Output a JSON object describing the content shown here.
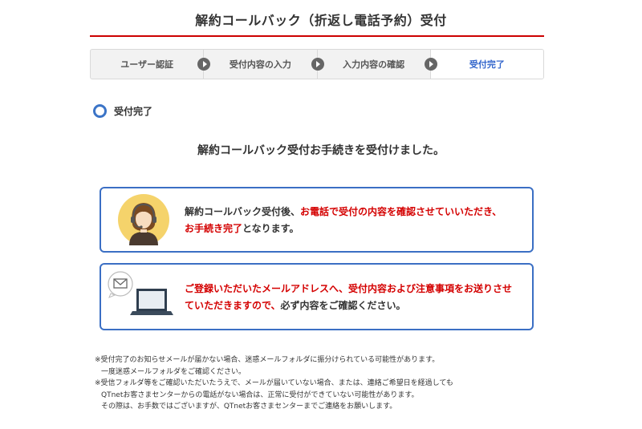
{
  "header": {
    "title": "解約コールバック（折返し電話予約）受付"
  },
  "stepper": {
    "steps": [
      {
        "label": "ユーザー認証"
      },
      {
        "label": "受付内容の入力"
      },
      {
        "label": "入力内容の確認"
      },
      {
        "label": "受付完了"
      }
    ],
    "active_index": 3
  },
  "section": {
    "title": "受付完了"
  },
  "message": {
    "headline": "解約コールバック受付お手続きを受付けました。"
  },
  "card_phone": {
    "icon": "operator-avatar-icon",
    "text_1": "解約コールバック受付後、",
    "text_2_red": "お電話で受付の内容を確認させていいただき、",
    "text_3_red": "お手続き完了",
    "text_4": "となります。"
  },
  "card_mail": {
    "icon": "mail-laptop-icon",
    "text_1_red": "ご登録いただいたメールアドレスへ、受付内容および注意事項をお送りさせていただきますので、",
    "text_2": "必ず内容をご確認ください。"
  },
  "notes": {
    "line_1": "※受付完了のお知らせメールが届かない場合、迷惑メールフォルダに振分けられている可能性があります。",
    "line_2": "一度迷惑メールフォルダをご確認ください。",
    "line_3": "※受信フォルダ等をご確認いただいたうえで、メールが届いていない場合、または、連絡ご希望日を経過しても",
    "line_4": "QTnetお客さまセンターからの電話がない場合は、正常に受付ができていない可能性があります。",
    "line_5": "その際は、お手数ではございますが、QTnetお客さまセンターまでご連絡をお願いします。"
  },
  "colors": {
    "accent_red": "#cc0000",
    "accent_blue": "#3b6fc4",
    "active_step": "#3366cc"
  }
}
